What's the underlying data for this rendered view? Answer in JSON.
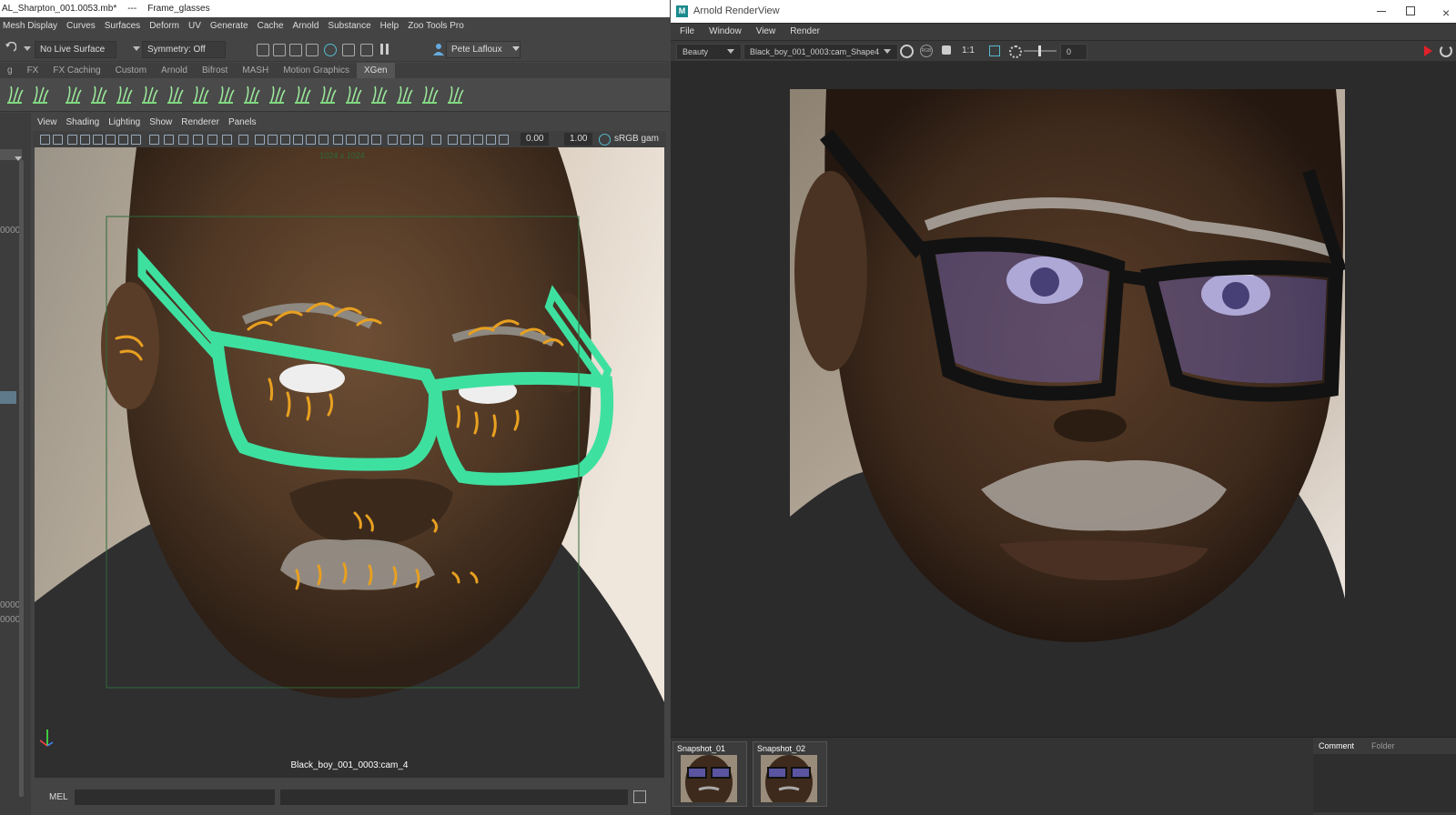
{
  "maya": {
    "title_file": "AL_Sharpton_001.0053.mb*",
    "title_sep": "---",
    "title_object": "Frame_glasses",
    "menu": [
      "Mesh Display",
      "Curves",
      "Surfaces",
      "Deform",
      "UV",
      "Generate",
      "Cache",
      "Arnold",
      "Substance",
      "Help",
      "Zoo Tools Pro"
    ],
    "status": {
      "live_surface": "No Live Surface",
      "symmetry": "Symmetry: Off",
      "user": "Pete Lafloux"
    },
    "shelf_tabs": [
      "g",
      "FX",
      "FX Caching",
      "Custom",
      "Arnold",
      "Bifrost",
      "MASH",
      "Motion Graphics",
      "XGen"
    ],
    "active_shelf_tab": "XGen",
    "left_values": [
      "0000",
      "0000",
      "0000"
    ],
    "viewport": {
      "menu": [
        "View",
        "Shading",
        "Lighting",
        "Show",
        "Renderer",
        "Panels"
      ],
      "exposure": "0.00",
      "gamma": "1.00",
      "color_space": "sRGB gam",
      "resolution": "1024 x 1024",
      "camera": "Black_boy_001_0003:cam_4"
    },
    "mel_label": "MEL",
    "colors": {
      "guide": "#e8a020",
      "glasses_wire": "#3ee0a0"
    }
  },
  "render_view": {
    "title": "Arnold RenderView",
    "menu": [
      "File",
      "Window",
      "View",
      "Render"
    ],
    "aov": "Beauty",
    "camera": "Black_boy_001_0003:cam_Shape4",
    "ratio": "1:1",
    "exposure_value": "0",
    "snapshots": [
      "Snapshot_01",
      "Snapshot_02"
    ],
    "panel_tabs": [
      "Comment",
      "Folder"
    ]
  }
}
